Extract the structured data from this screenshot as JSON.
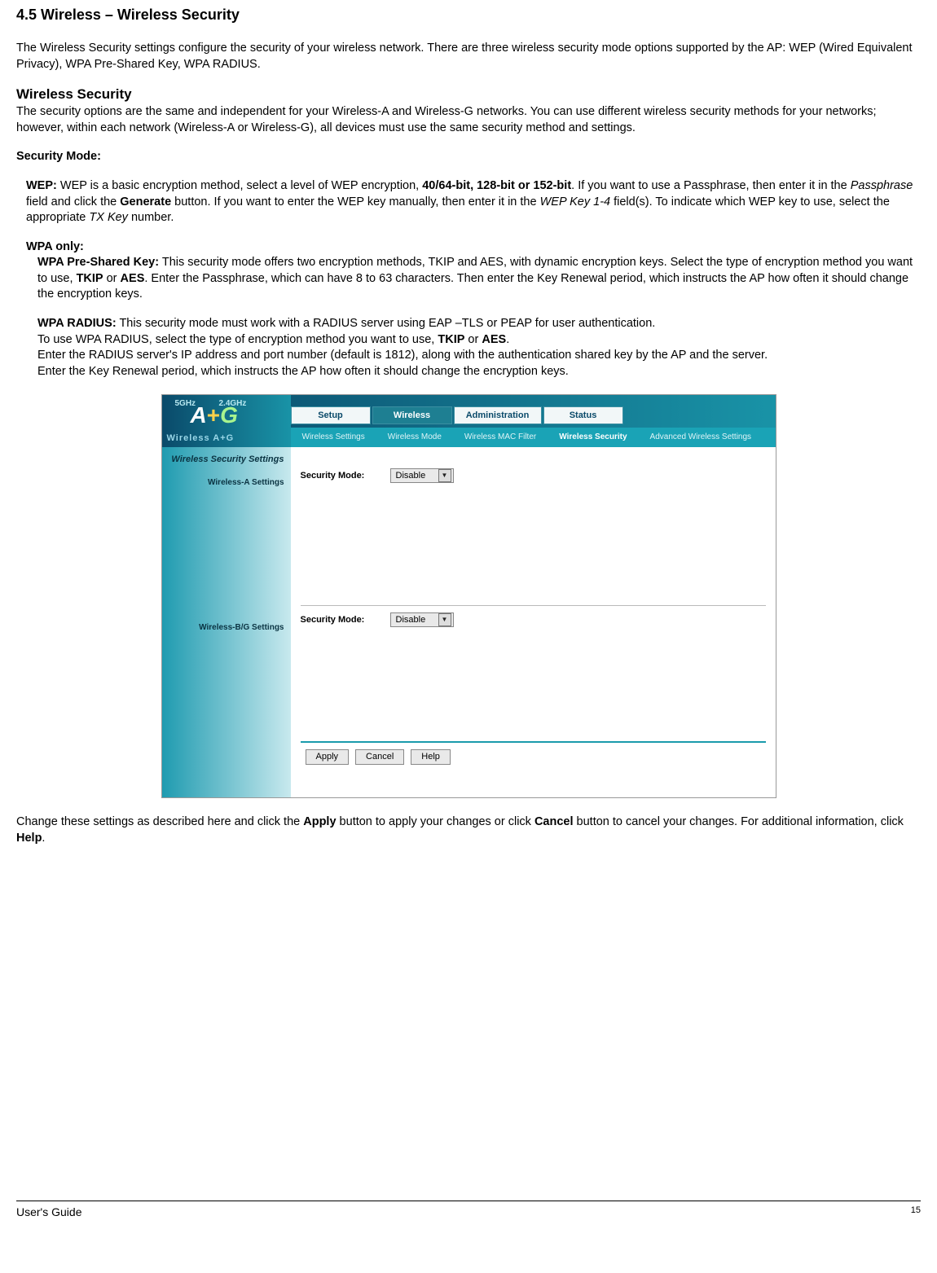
{
  "heading": "4.5 Wireless – Wireless Security",
  "intro": "The Wireless Security settings configure the security of your wireless network. There are three wireless security mode options supported by the AP: WEP (Wired Equivalent Privacy), WPA Pre-Shared Key, WPA RADIUS.",
  "wireless_security_heading": "Wireless Security",
  "wireless_security_text": "The security options are the same and independent for your Wireless-A and Wireless-G networks. You can use different wireless security methods for your networks; however, within each network (Wireless-A or Wireless-G), all devices must use the same security method and settings.",
  "security_mode_label": "Security Mode:",
  "wep_label": "WEP:",
  "wep_text_1": " WEP is a basic encryption method, select a level of WEP encryption, ",
  "wep_bits": "40/64-bit, 128-bit or 152-bit",
  "wep_text_2": ". If you want to use a Passphrase, then enter it in the ",
  "passphrase_i": "Passphrase",
  "wep_text_3": " field and click the ",
  "generate_b": "Generate",
  "wep_text_4": " button. If you want to enter the WEP key manually, then enter it in the ",
  "wepkey_i": "WEP Key 1-4",
  "wep_text_5": " field(s). To indicate which WEP key to use, select the appropriate ",
  "txkey_i": "TX Key",
  "wep_text_6": " number.",
  "wpa_only_label": "WPA only:",
  "wpa_psk_label": "WPA Pre-Shared Key:",
  "wpa_psk_text_1": " This security mode offers two encryption methods, TKIP and AES, with dynamic encryption keys. Select the type of encryption method you want to use, ",
  "tkip_b": "TKIP",
  "or_text": " or ",
  "aes_b": "AES",
  "wpa_psk_text_2": ". Enter the Passphrase, which can have 8 to 63 characters. Then enter the Key Renewal period, which instructs the AP how often it should change the encryption keys.",
  "wpa_radius_label": "WPA RADIUS:",
  "wpa_radius_text_1": " This security mode must work with a RADIUS server using EAP –TLS or PEAP for user authentication.",
  "wpa_radius_text_2a": "To use WPA RADIUS, select the type of encryption method you want to use, ",
  "wpa_radius_text_2b": ".",
  "wpa_radius_text_3": "Enter the RADIUS server's IP address and port number (default is 1812), along with the authentication shared key by the AP and the server.",
  "wpa_radius_text_4": "Enter the Key Renewal period, which instructs the AP how often it should change the encryption keys.",
  "screenshot": {
    "brand_5ghz": "5GHz",
    "brand_24ghz": "2.4GHz",
    "brand_logo_a": "A",
    "brand_logo_plus": "+",
    "brand_logo_g": "G",
    "brand_line": "Wireless A+G",
    "tabs": {
      "setup": "Setup",
      "wireless": "Wireless",
      "admin": "Administration",
      "status": "Status"
    },
    "subtabs": {
      "settings": "Wireless Settings",
      "mode": "Wireless Mode",
      "mac": "Wireless MAC Filter",
      "security": "Wireless Security",
      "advanced": "Advanced Wireless Settings"
    },
    "left_title": "Wireless Security Settings",
    "left_a": "Wireless-A Settings",
    "left_bg": "Wireless-B/G Settings",
    "field_label": "Security Mode:",
    "select_value": "Disable",
    "buttons": {
      "apply": "Apply",
      "cancel": "Cancel",
      "help": "Help"
    }
  },
  "outro_1": "Change these settings as described here and click the ",
  "apply_b": "Apply",
  "outro_2": " button to apply your changes or click ",
  "cancel_b": "Cancel",
  "outro_3": " button to cancel your changes. For additional information, click ",
  "help_b": "Help",
  "outro_4": ".",
  "footer_guide": "User's Guide",
  "footer_page": "15"
}
